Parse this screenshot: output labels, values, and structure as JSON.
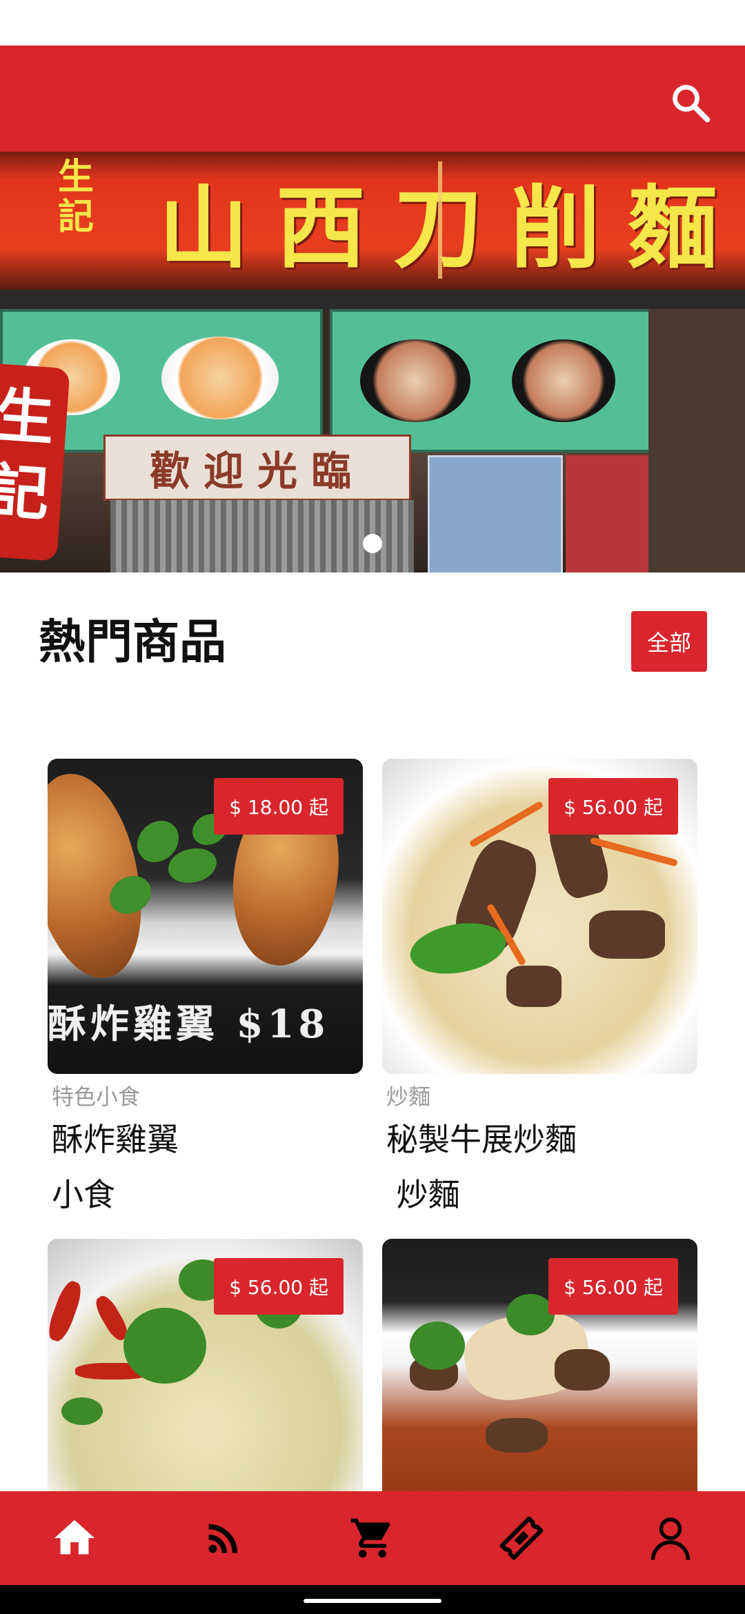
{
  "header": {
    "search_icon": "search-icon"
  },
  "banner": {
    "sign_text": "山西刀削麵",
    "sign_small": "生記",
    "welcome_text": "歡迎光臨",
    "badge_text": "生記",
    "slide_count": 1
  },
  "section": {
    "title": "熱門商品",
    "all_label": "全部"
  },
  "products": [
    {
      "price": "$ 18.00 起",
      "category": "特色小食",
      "name": "酥炸雞翼",
      "subtitle": "小食",
      "image_caption": "酥炸雞翼 $18"
    },
    {
      "price": "$ 56.00 起",
      "category": "炒麵",
      "name": "秘製牛展炒麵",
      "subtitle": " 炒麵"
    },
    {
      "price": "$ 56.00 起"
    },
    {
      "price": "$ 56.00 起"
    }
  ],
  "bottom_nav": [
    {
      "icon": "home-icon",
      "active": true
    },
    {
      "icon": "rss-icon"
    },
    {
      "icon": "cart-icon"
    },
    {
      "icon": "ticket-icon"
    },
    {
      "icon": "profile-icon"
    }
  ],
  "colors": {
    "brand": "#d8262c",
    "text_primary": "#111111",
    "text_secondary": "#9a9a9a",
    "nav_active": "#ffffff",
    "nav_inactive": "#000000"
  }
}
